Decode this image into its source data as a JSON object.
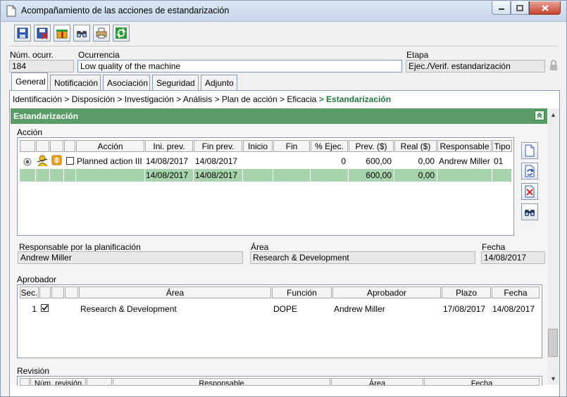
{
  "window": {
    "title": "Acompañamiento de las acciones de estandarización"
  },
  "toolbar": {
    "buttons": [
      {
        "name": "save-icon"
      },
      {
        "name": "save-close-icon"
      },
      {
        "name": "gift-icon"
      },
      {
        "name": "binoculars-icon"
      },
      {
        "name": "print-icon"
      },
      {
        "name": "refresh-icon"
      }
    ]
  },
  "header": {
    "num_label": "Núm. ocurr.",
    "num_value": "184",
    "ocurrencia_label": "Ocurrencia",
    "ocurrencia_value": "Low quality of the machine",
    "etapa_label": "Etapa",
    "etapa_value": "Ejec./Verif. estandarización"
  },
  "tabs": [
    "General",
    "Notificación",
    "Asociación",
    "Seguridad",
    "Adjunto"
  ],
  "breadcrumb": {
    "items": [
      "Identificación",
      "Disposición",
      "Investigación",
      "Análisis",
      "Plan de acción",
      "Eficacia"
    ],
    "separator": ">",
    "current": "> Estandarización"
  },
  "section": {
    "title": "Estandarización"
  },
  "accion": {
    "label": "Acción",
    "columns": [
      "Acción",
      "Ini. prev.",
      "Fin prev.",
      "Inicio",
      "Fin",
      "% Ejec.",
      "Prev. ($)",
      "Real ($)",
      "Responsable",
      "Tipo"
    ],
    "row": {
      "accion": "Planned action III",
      "ini_prev": "14/08/2017",
      "fin_prev": "14/08/2017",
      "inicio": "",
      "fin": "",
      "ejec": "0",
      "prev": "600,00",
      "real": "0,00",
      "responsable": "Andrew Miller",
      "tipo": "01"
    },
    "total": {
      "ini_prev": "14/08/2017",
      "fin_prev": "14/08/2017",
      "prev": "600,00",
      "real": "0,00"
    }
  },
  "planificacion": {
    "responsable_label": "Responsable por la planificación",
    "responsable_value": "Andrew Miller",
    "area_label": "Área",
    "area_value": "Research & Development",
    "fecha_label": "Fecha",
    "fecha_value": "14/08/2017"
  },
  "aprobador": {
    "label": "Aprobador",
    "columns": [
      "Sec.",
      "Área",
      "Función",
      "Aprobador",
      "Plazo",
      "Fecha"
    ],
    "row": {
      "sec": "1",
      "area": "Research & Development",
      "funcion": "DOPE",
      "aprobador": "Andrew Miller",
      "plazo": "17/08/2017",
      "fecha": "14/08/2017"
    }
  },
  "revision": {
    "label": "Revisión",
    "columns": [
      "Núm. revisión",
      "Responsable",
      "Área",
      "Fecha"
    ]
  }
}
